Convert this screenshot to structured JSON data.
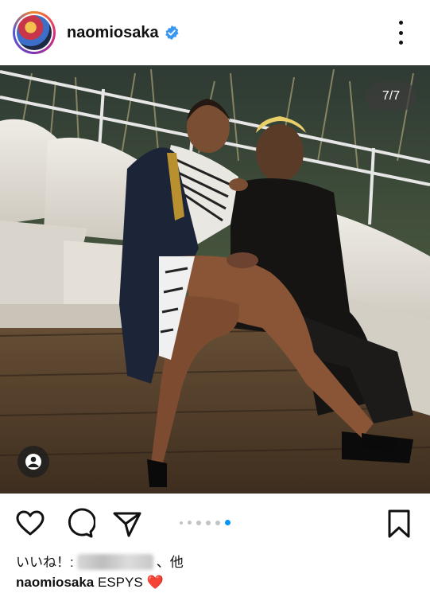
{
  "header": {
    "username": "naomiosaka",
    "verified_icon": "verified-badge-icon",
    "more_icon": "more-vertical-icon"
  },
  "post": {
    "image_counter": "7/7",
    "tag_icon": "user-tag-icon"
  },
  "actions": {
    "like_icon": "heart-icon",
    "comment_icon": "comment-icon",
    "share_icon": "send-icon",
    "save_icon": "bookmark-icon",
    "carousel_total": 7,
    "carousel_active": 7
  },
  "likes": {
    "prefix": "いいね！:",
    "suffix": "、他"
  },
  "caption": {
    "username": "naomiosaka",
    "text": "ESPYS",
    "emoji": "❤️"
  },
  "colors": {
    "accent": "#0095f6",
    "verified": "#3897f0",
    "heart_emoji": "#e0245e"
  }
}
